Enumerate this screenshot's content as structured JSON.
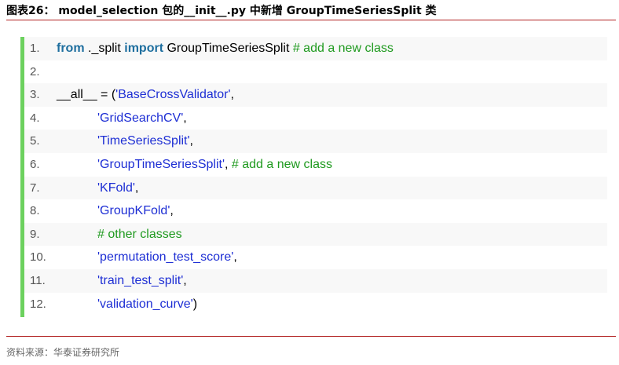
{
  "figure": {
    "title": "图表26：  model_selection 包的__init__.py 中新增 GroupTimeSeriesSplit 类",
    "source": "资料来源：华泰证券研究所"
  },
  "code": {
    "lines": [
      {
        "no": "1.",
        "parts": [
          {
            "t": "from",
            "c": "kw"
          },
          {
            "t": " ._split ",
            "c": "pl"
          },
          {
            "t": "import",
            "c": "kw"
          },
          {
            "t": " GroupTimeSeriesSplit ",
            "c": "pl"
          },
          {
            "t": "# add a new class",
            "c": "cm"
          }
        ]
      },
      {
        "no": "2.",
        "parts": []
      },
      {
        "no": "3.",
        "parts": [
          {
            "t": "__all__ = (",
            "c": "pl"
          },
          {
            "t": "'BaseCrossValidator'",
            "c": "str"
          },
          {
            "t": ",",
            "c": "pl"
          }
        ]
      },
      {
        "no": "4.",
        "indent": true,
        "parts": [
          {
            "t": "'GridSearchCV'",
            "c": "str"
          },
          {
            "t": ",",
            "c": "pl"
          }
        ]
      },
      {
        "no": "5.",
        "indent": true,
        "parts": [
          {
            "t": "'TimeSeriesSplit'",
            "c": "str"
          },
          {
            "t": ",",
            "c": "pl"
          }
        ]
      },
      {
        "no": "6.",
        "indent": true,
        "parts": [
          {
            "t": "'GroupTimeSeriesSplit'",
            "c": "str"
          },
          {
            "t": ", ",
            "c": "pl"
          },
          {
            "t": "# add a new class",
            "c": "cm"
          }
        ]
      },
      {
        "no": "7.",
        "indent": true,
        "parts": [
          {
            "t": "'KFold'",
            "c": "str"
          },
          {
            "t": ",",
            "c": "pl"
          }
        ]
      },
      {
        "no": "8.",
        "indent": true,
        "parts": [
          {
            "t": "'GroupKFold'",
            "c": "str"
          },
          {
            "t": ",",
            "c": "pl"
          }
        ]
      },
      {
        "no": "9.",
        "indent": true,
        "parts": [
          {
            "t": "# other classes",
            "c": "cm"
          }
        ]
      },
      {
        "no": "10.",
        "indent": true,
        "parts": [
          {
            "t": "'permutation_test_score'",
            "c": "str"
          },
          {
            "t": ",",
            "c": "pl"
          }
        ]
      },
      {
        "no": "11.",
        "indent": true,
        "parts": [
          {
            "t": "'train_test_split'",
            "c": "str"
          },
          {
            "t": ",",
            "c": "pl"
          }
        ]
      },
      {
        "no": "12.",
        "indent": true,
        "parts": [
          {
            "t": "'validation_curve'",
            "c": "str"
          },
          {
            "t": ")",
            "c": "pl"
          }
        ]
      }
    ]
  }
}
